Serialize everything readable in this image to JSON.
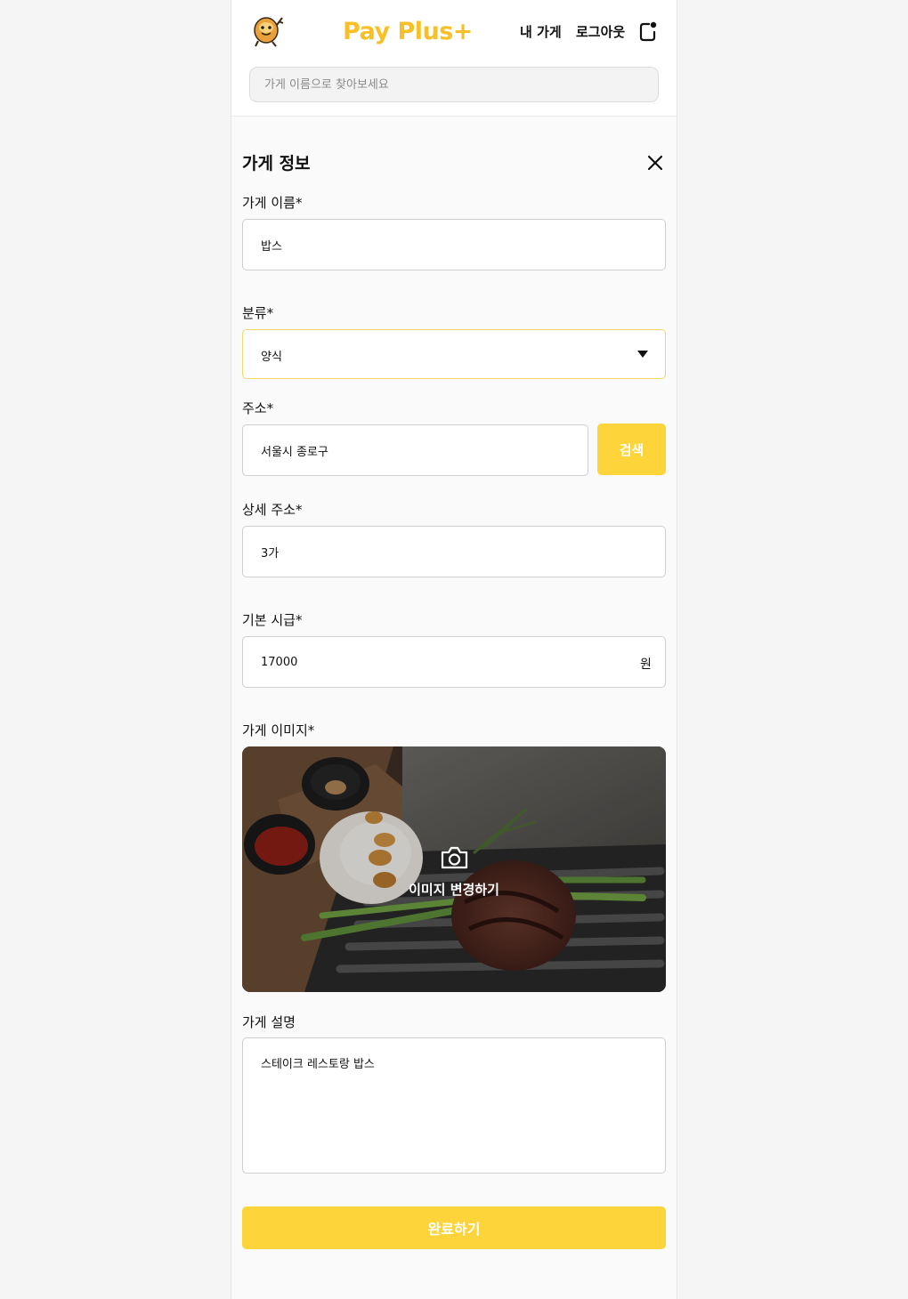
{
  "header": {
    "brand": "Pay Plus+",
    "nav_mystore": "내 가게",
    "nav_logout": "로그아웃",
    "search_placeholder": "가게 이름으로 찾아보세요"
  },
  "form": {
    "title": "가게 정보",
    "name_label": "가게 이름*",
    "name_value": "밥스",
    "category_label": "분류*",
    "category_value": "양식",
    "address_label": "주소*",
    "address_value": "서울시 종로구",
    "search_button": "검색",
    "detail_label": "상세 주소*",
    "detail_value": "3가",
    "wage_label": "기본 시급*",
    "wage_value": "17000",
    "wage_unit": "원",
    "image_label": "가게 이미지*",
    "image_change": "이미지 변경하기",
    "desc_label": "가게 설명",
    "desc_value": "스테이크 레스토랑 밥스",
    "submit": "완료하기"
  },
  "colors": {
    "accent": "#fed43b",
    "brand": "#f8c028"
  },
  "icons": [
    "mascot-logo-icon",
    "logout-icon",
    "close-icon",
    "chevron-down-icon",
    "camera-icon"
  ]
}
